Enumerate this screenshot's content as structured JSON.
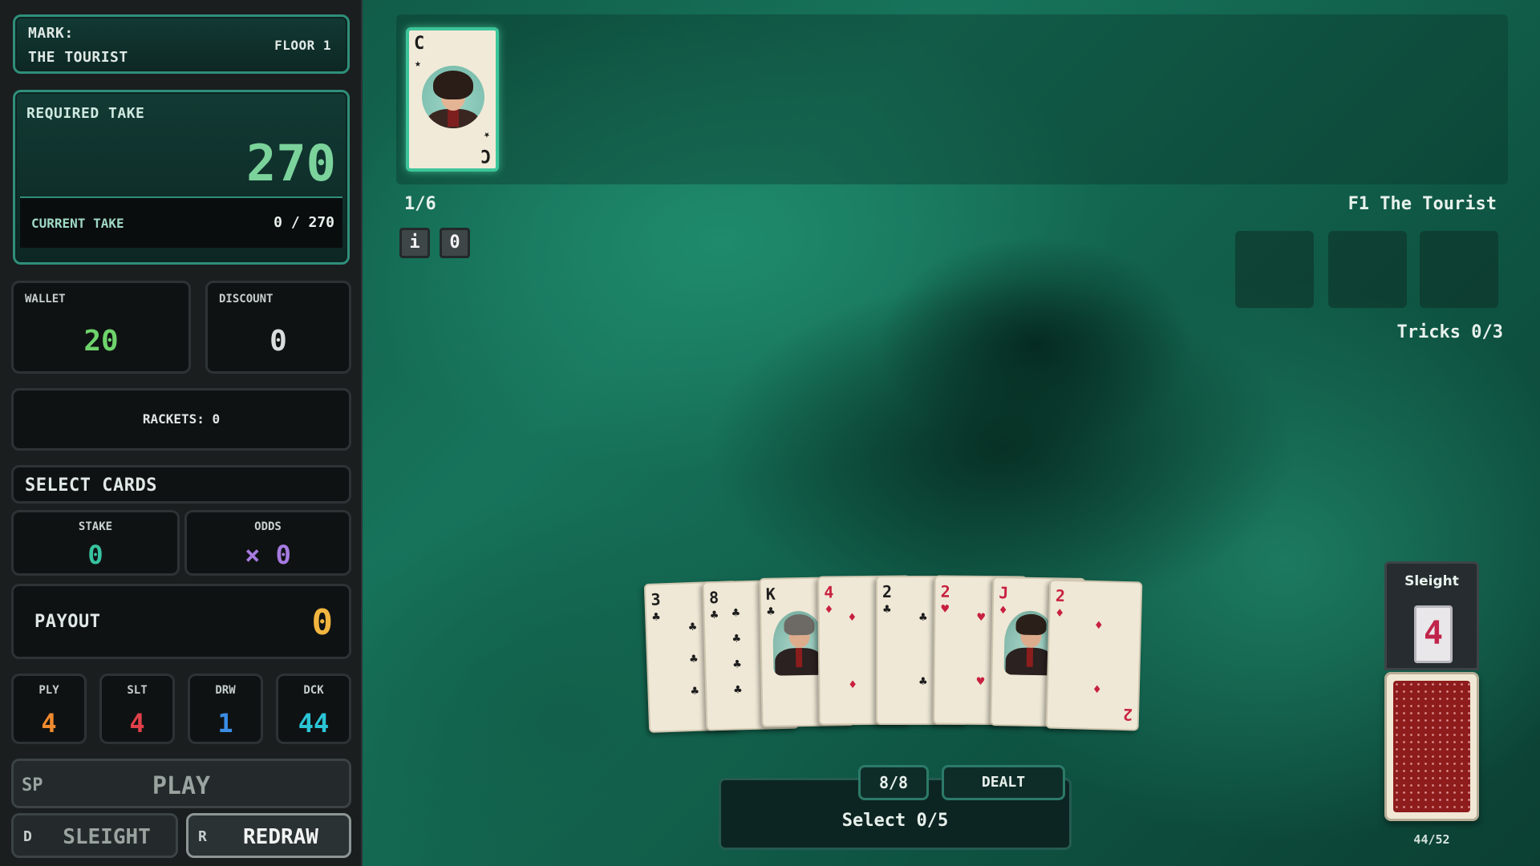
{
  "left_panel": {
    "mark_label": "MARK:",
    "mark_name": "THE TOURIST",
    "floor": "FLOOR 1",
    "required_take_label": "REQUIRED TAKE",
    "required_take": "270",
    "current_take_label": "CURRENT TAKE",
    "current_take": "0 / 270",
    "wallet_label": "WALLET",
    "wallet": "20",
    "discount_label": "DISCOUNT",
    "discount": "0",
    "rackets": "RACKETS: 0",
    "select_label": "SELECT CARDS",
    "stake_label": "STAKE",
    "stake": "0",
    "odds_label": "ODDS",
    "odds": "× 0",
    "payout_label": "PAYOUT",
    "payout": "0",
    "stats": [
      {
        "label": "PLY",
        "value": "4",
        "color": "#f08a2e"
      },
      {
        "label": "SLT",
        "value": "4",
        "color": "#e0404a"
      },
      {
        "label": "DRW",
        "value": "1",
        "color": "#3b8de6"
      },
      {
        "label": "DCK",
        "value": "44",
        "color": "#2bc4d6"
      }
    ],
    "play_key": "SP",
    "play_label": "PLAY",
    "sleight_key": "D",
    "sleight_label": "SLEIGHT",
    "redraw_key": "R",
    "redraw_label": "REDRAW"
  },
  "top": {
    "mark_card": {
      "rank": "C",
      "star": "★"
    },
    "round": "1/6",
    "info_btn": "i",
    "o_btn": "0",
    "floor_title": "F1 The Tourist",
    "tricks": "Tricks 0/3"
  },
  "hand": [
    {
      "rank": "3",
      "suit": "♣",
      "color": "#1d1d1d"
    },
    {
      "rank": "8",
      "suit": "♣",
      "color": "#1d1d1d"
    },
    {
      "rank": "K",
      "suit": "♣",
      "color": "#1d1d1d",
      "face": true
    },
    {
      "rank": "4",
      "suit": "♦",
      "color": "#c8203f"
    },
    {
      "rank": "2",
      "suit": "♣",
      "color": "#1d1d1d"
    },
    {
      "rank": "2",
      "suit": "♥",
      "color": "#c8203f"
    },
    {
      "rank": "J",
      "suit": "♦",
      "color": "#c8203f",
      "face": true
    },
    {
      "rank": "2",
      "suit": "♦",
      "color": "#c8203f"
    }
  ],
  "bottom": {
    "hand_count": "8/8",
    "dealt": "DEALT",
    "select_status": "Select 0/5"
  },
  "right": {
    "sleight_title": "Sleight",
    "sleight_value": "4",
    "deck_count": "44/52"
  },
  "colors": {
    "accent_teal": "#2f8f7a",
    "take_green": "#7bd39b",
    "payout_gold": "#f2b53f",
    "stake_teal": "#37c3a0",
    "odds_purple": "#a77be0"
  }
}
